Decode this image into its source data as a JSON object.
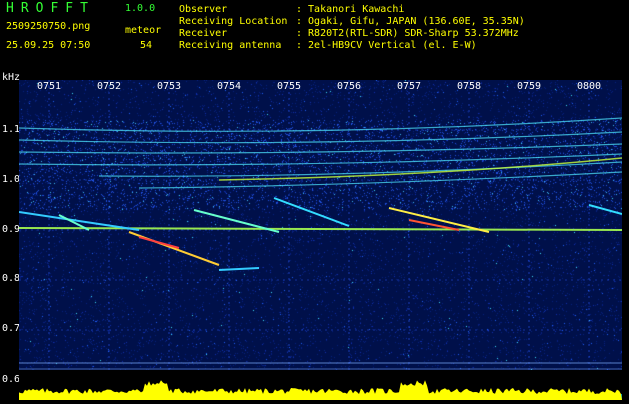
{
  "header": {
    "app_title": "HROFFT",
    "app_version": "1.0.0",
    "file_name": "2509250750.png",
    "meteor_label": "meteor",
    "datetime": "25.09.25 07:50",
    "meteor_count": "54"
  },
  "info": [
    {
      "key": "Observer",
      "value": ": Takanori Kawachi"
    },
    {
      "key": "Receiving Location",
      "value": ": Ogaki, Gifu, JAPAN (136.60E, 35.35N)"
    },
    {
      "key": "Receiver",
      "value": ": R820T2(RTL-SDR) SDR-Sharp 53.372MHz"
    },
    {
      "key": "Receiving antenna",
      "value": ": 2el-HB9CV Vertical (el. E-W)"
    }
  ],
  "axes": {
    "y_unit": "kHz",
    "y_ticks": [
      "1.1",
      "1.0",
      "0.9",
      "0.8",
      "0.7",
      "0.6"
    ],
    "x_ticks": [
      "0751",
      "0752",
      "0753",
      "0754",
      "0755",
      "0756",
      "0757",
      "0758",
      "0759",
      "0800"
    ]
  },
  "colors": {
    "text_green": "#34ff34",
    "text_yellow": "#ffff00",
    "text_white": "#ffffff",
    "background": "#00104a",
    "waveform": "#ffff00",
    "waveform_base": "#00e5ff"
  }
}
